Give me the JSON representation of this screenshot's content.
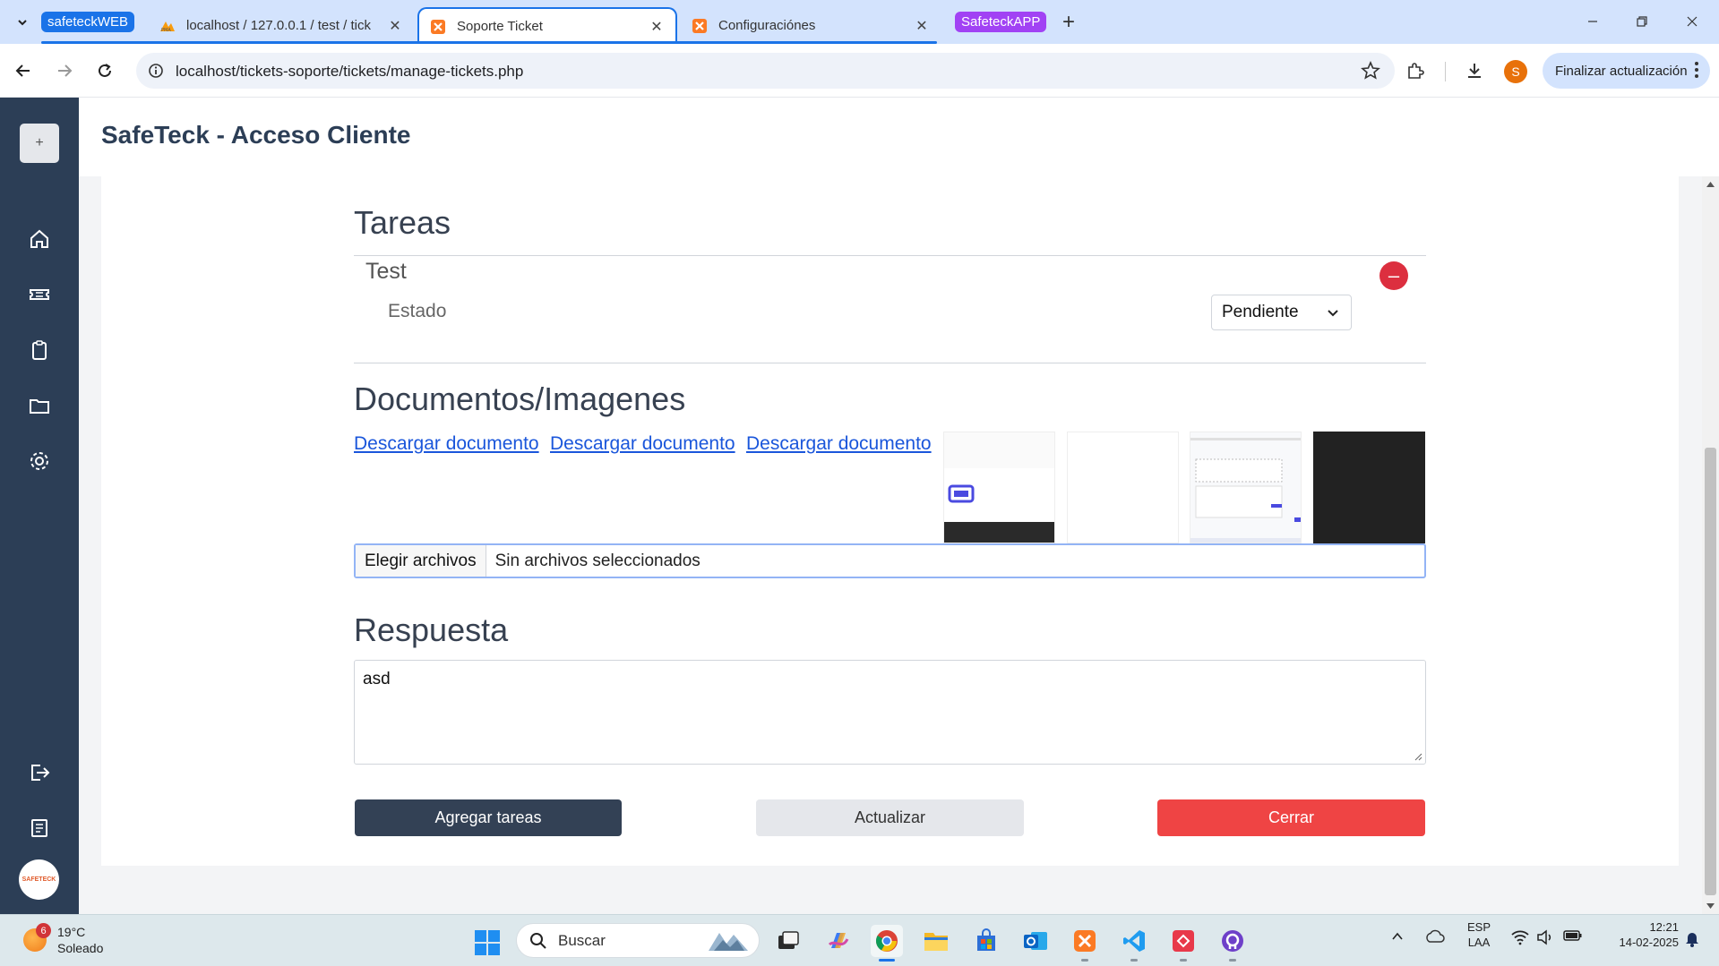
{
  "browser": {
    "tab_groups": [
      {
        "label": "safeteckWEB",
        "color": "#1a73e8"
      },
      {
        "label": "SafeteckAPP",
        "color": "#a142f4"
      }
    ],
    "tabs": [
      {
        "title": "localhost / 127.0.0.1 / test / tick",
        "icon": "phpmyadmin-icon",
        "active": false
      },
      {
        "title": "Soporte Ticket",
        "icon": "xampp-icon",
        "active": true
      },
      {
        "title": "Configuraciónes",
        "icon": "xampp-icon",
        "active": false
      }
    ],
    "url": "localhost/tickets-soporte/tickets/manage-tickets.php",
    "profile_initial": "S",
    "update_button": "Finalizar actualización"
  },
  "sidebar": {
    "top_button": "+",
    "items": [
      "home-icon",
      "ticket-icon",
      "clipboard-icon",
      "folder-icon",
      "settings-icon"
    ],
    "bottom_items": [
      "logout-icon",
      "report-icon"
    ],
    "logo_text": "SAFETECK"
  },
  "header": {
    "title": "SafeTeck - Acceso Cliente"
  },
  "tasks": {
    "section_title": "Tareas",
    "items": [
      {
        "name": "Test",
        "status_label": "Estado",
        "status_value": "Pendiente",
        "remove_symbol": "–"
      }
    ]
  },
  "documents": {
    "section_title": "Documentos/Imagenes",
    "links": [
      "Descargar documento",
      "Descargar documento",
      "Descargar documento"
    ],
    "file_input": {
      "button_label": "Elegir archivos",
      "status": "Sin archivos seleccionados"
    }
  },
  "response": {
    "section_title": "Respuesta",
    "value": "asd"
  },
  "actions": {
    "add_tasks": "Agregar tareas",
    "update": "Actualizar",
    "close": "Cerrar"
  },
  "taskbar": {
    "weather": {
      "temp": "19°C",
      "condition": "Soleado",
      "badge": "6"
    },
    "search_placeholder": "Buscar",
    "language": {
      "lang": "ESP",
      "layout": "LAA"
    },
    "clock": {
      "time": "12:21",
      "date": "14-02-2025"
    }
  },
  "colors": {
    "sidebar": "#2c3e56",
    "primary_dark": "#334155",
    "danger": "#ef4444",
    "link": "#1a56db"
  }
}
